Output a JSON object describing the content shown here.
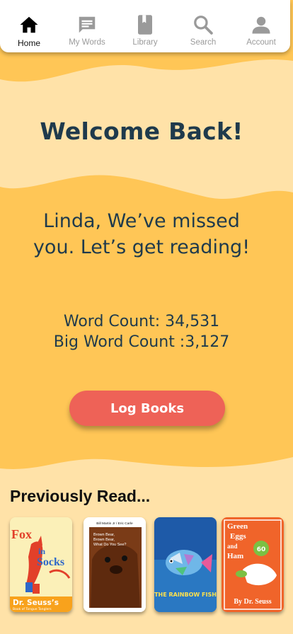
{
  "nav": {
    "items": [
      {
        "label": "Home",
        "icon": "home-icon",
        "active": true
      },
      {
        "label": "My Words",
        "icon": "chat-icon",
        "active": false
      },
      {
        "label": "Library",
        "icon": "book-icon",
        "active": false
      },
      {
        "label": "Search",
        "icon": "search-icon",
        "active": false
      },
      {
        "label": "Account",
        "icon": "person-icon",
        "active": false
      }
    ]
  },
  "welcome": "Welcome Back!",
  "greeting": "Linda, We’ve missed you.  Let’s get reading!",
  "stats": {
    "word_count": "Word Count: 34,531",
    "big_word_count": "Big Word Count :3,127"
  },
  "log_button": "Log Books",
  "previously_read": {
    "title": "Previously Read...",
    "books": [
      {
        "cover": {
          "line1": "Fox",
          "line2": "in",
          "line3": "Socks",
          "author": "Dr. Seuss’s",
          "subtitle": "Book of Tongue Tanglers"
        }
      },
      {
        "cover": {
          "authors": "Bill Martin Jr / Eric Carle",
          "title_lines": [
            "Brown Bear,",
            "Brown Bear,",
            "What Do You See?"
          ]
        }
      },
      {
        "cover": {
          "title": "THE RAINBOW FISH"
        }
      },
      {
        "cover": {
          "line1": "Green",
          "line2": "Eggs",
          "line3": "and",
          "line4": "Ham",
          "badge": "60",
          "author": "By Dr. Seuss"
        }
      }
    ]
  },
  "colors": {
    "background": "#FFC656",
    "wave": "#FFE2A8",
    "text_dark": "#1F3A4C",
    "button": "#EE6257"
  }
}
